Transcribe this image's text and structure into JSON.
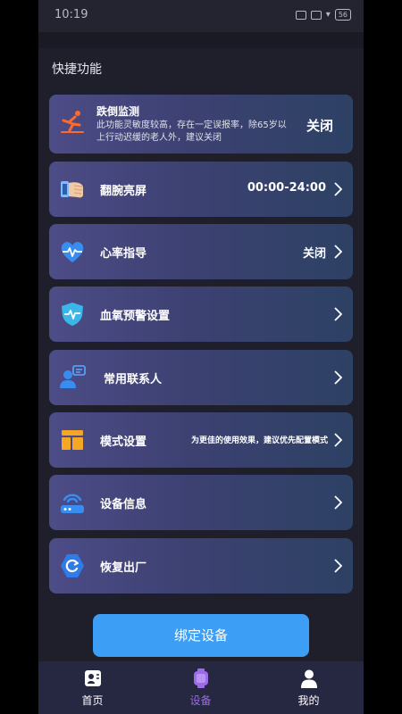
{
  "status_bar": {
    "time": "10:19",
    "battery": "56"
  },
  "section_title": "快捷功能",
  "cards": {
    "fall_detection": {
      "title": "跌倒监测",
      "description": "此功能灵敏度较高，存在一定误报率，除65岁以上行动迟缓的老人外，建议关闭",
      "state": "关闭"
    },
    "raise_wrist": {
      "label": "翻腕亮屏",
      "value": "00:00-24:00"
    },
    "heart_rate": {
      "label": "心率指导",
      "value": "关闭"
    },
    "spo2_alert": {
      "label": "血氧预警设置"
    },
    "contacts": {
      "label": "常用联系人"
    },
    "mode": {
      "label": "模式设置",
      "hint": "为更佳的使用效果，建议优先配置模式"
    },
    "device_info": {
      "label": "设备信息"
    },
    "factory_reset": {
      "label": "恢复出厂"
    }
  },
  "bind_button": "绑定设备",
  "tabs": {
    "home": "首页",
    "device": "设备",
    "mine": "我的"
  },
  "colors": {
    "accent": "#3d9ef5",
    "active_tab": "#9c6be8",
    "fall_icon": "#ff6a2c"
  },
  "icons": {
    "fall": "fall-person-icon",
    "raise_wrist": "wrist-hand-icon",
    "heart_rate": "heart-pulse-icon",
    "spo2": "shield-pulse-icon",
    "contacts": "contacts-chat-icon",
    "mode": "layout-panel-icon",
    "device_info": "router-wifi-icon",
    "reset": "hexagon-refresh-icon"
  }
}
